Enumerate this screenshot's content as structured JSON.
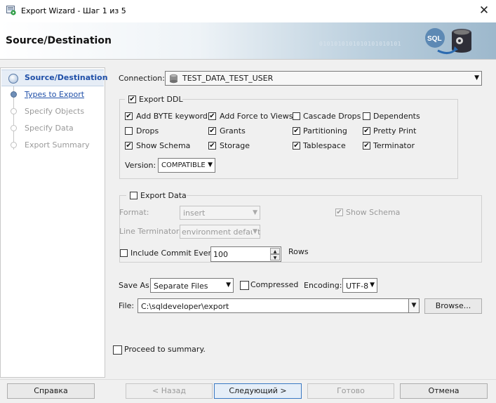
{
  "window": {
    "title": "Export Wizard - Шаг 1 из 5",
    "close_label": "✕"
  },
  "banner": {
    "title": "Source/Destination",
    "binary": "0101010101010101010101"
  },
  "nav": {
    "items": [
      {
        "label": "Source/Destination",
        "state": "current"
      },
      {
        "label": "Types to Export",
        "state": "link"
      },
      {
        "label": "Specify Objects",
        "state": "disabled"
      },
      {
        "label": "Specify Data",
        "state": "disabled"
      },
      {
        "label": "Export Summary",
        "state": "disabled"
      }
    ]
  },
  "connection": {
    "label": "Connection:",
    "value": "TEST_DATA_TEST_USER"
  },
  "export_ddl": {
    "label": "Export DDL",
    "checked": true,
    "options": [
      {
        "label": "Add BYTE keyword",
        "checked": true
      },
      {
        "label": "Add Force to Views",
        "checked": true
      },
      {
        "label": "Cascade Drops",
        "checked": false
      },
      {
        "label": "Dependents",
        "checked": false
      },
      {
        "label": "Drops",
        "checked": false
      },
      {
        "label": "Grants",
        "checked": true
      },
      {
        "label": "Partitioning",
        "checked": true
      },
      {
        "label": "Pretty Print",
        "checked": true
      },
      {
        "label": "Show Schema",
        "checked": true
      },
      {
        "label": "Storage",
        "checked": true
      },
      {
        "label": "Tablespace",
        "checked": true
      },
      {
        "label": "Terminator",
        "checked": true
      }
    ],
    "version_label": "Version:",
    "version_value": "COMPATIBLE"
  },
  "export_data": {
    "label": "Export Data",
    "checked": false,
    "format_label": "Format:",
    "format_value": "insert",
    "show_schema_label": "Show Schema",
    "line_terminator_label": "Line Terminator:",
    "line_terminator_value": "environment default",
    "commit_label": "Include Commit Every",
    "commit_value": "100",
    "rows_label": "Rows"
  },
  "save_as": {
    "label": "Save As",
    "value": "Separate Files",
    "compressed_label": "Compressed",
    "encoding_label": "Encoding:",
    "encoding_value": "UTF-8"
  },
  "file": {
    "label": "File:",
    "value": "C:\\sqldeveloper\\export",
    "browse_label": "Browse..."
  },
  "proceed": {
    "label": "Proceed to summary."
  },
  "footer": {
    "help": "Справка",
    "back": "< Назад",
    "next": "Следующий >",
    "finish": "Готово",
    "cancel": "Отмена"
  },
  "icons": {
    "checkmark": "✔",
    "arrow": "▼",
    "up": "▲"
  },
  "colors": {
    "link": "#1f4fa8",
    "accent": "#3a78c3",
    "nav_active": "#1f4fa8"
  }
}
